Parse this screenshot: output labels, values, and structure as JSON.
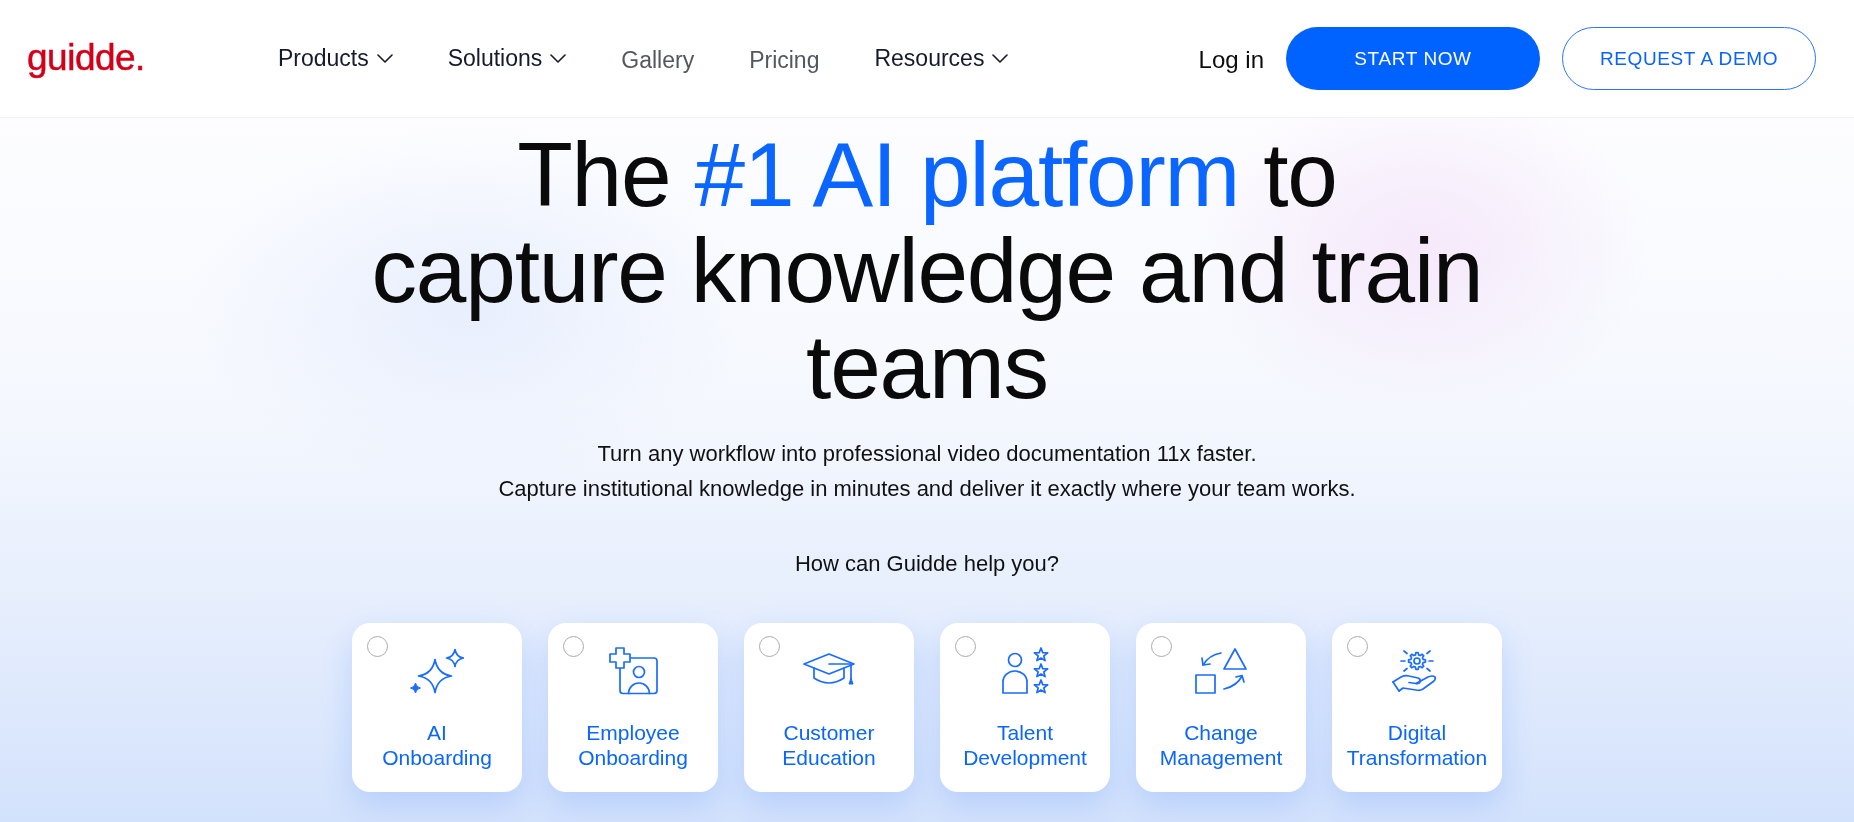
{
  "header": {
    "logo": "guidde.",
    "nav": [
      {
        "label": "Products",
        "kind": "dropdown"
      },
      {
        "label": "Solutions",
        "kind": "dropdown"
      },
      {
        "label": "Gallery",
        "kind": "link"
      },
      {
        "label": "Pricing",
        "kind": "link"
      },
      {
        "label": "Resources",
        "kind": "dropdown"
      }
    ],
    "login": "Log in",
    "buttons": [
      {
        "label": "START NOW",
        "kind": "primary"
      },
      {
        "label": "REQUEST A DEMO",
        "kind": "outline"
      }
    ]
  },
  "hero": {
    "headline_lines": [
      [
        {
          "text": "The ",
          "highlight": false
        },
        {
          "text": "#1 AI platform",
          "highlight": true
        },
        {
          "text": " to",
          "highlight": false
        }
      ],
      [
        {
          "text": "capture knowledge and train",
          "highlight": false
        }
      ],
      [
        {
          "text": "teams",
          "highlight": false
        }
      ]
    ],
    "subtitle_lines": [
      "Turn any workflow into professional video documentation 11x faster.",
      "Capture institutional knowledge in minutes and deliver it exactly where your team works."
    ],
    "question": "How can Guidde help you?",
    "options": [
      {
        "label": "AI Onboarding",
        "selected": false
      },
      {
        "label": "Employee Onboarding",
        "selected": false
      },
      {
        "label": "Customer Education",
        "selected": false
      },
      {
        "label": "Talent Development",
        "selected": false
      },
      {
        "label": "Change Management",
        "selected": false
      },
      {
        "label": "Digital Transformation",
        "selected": false
      }
    ]
  }
}
